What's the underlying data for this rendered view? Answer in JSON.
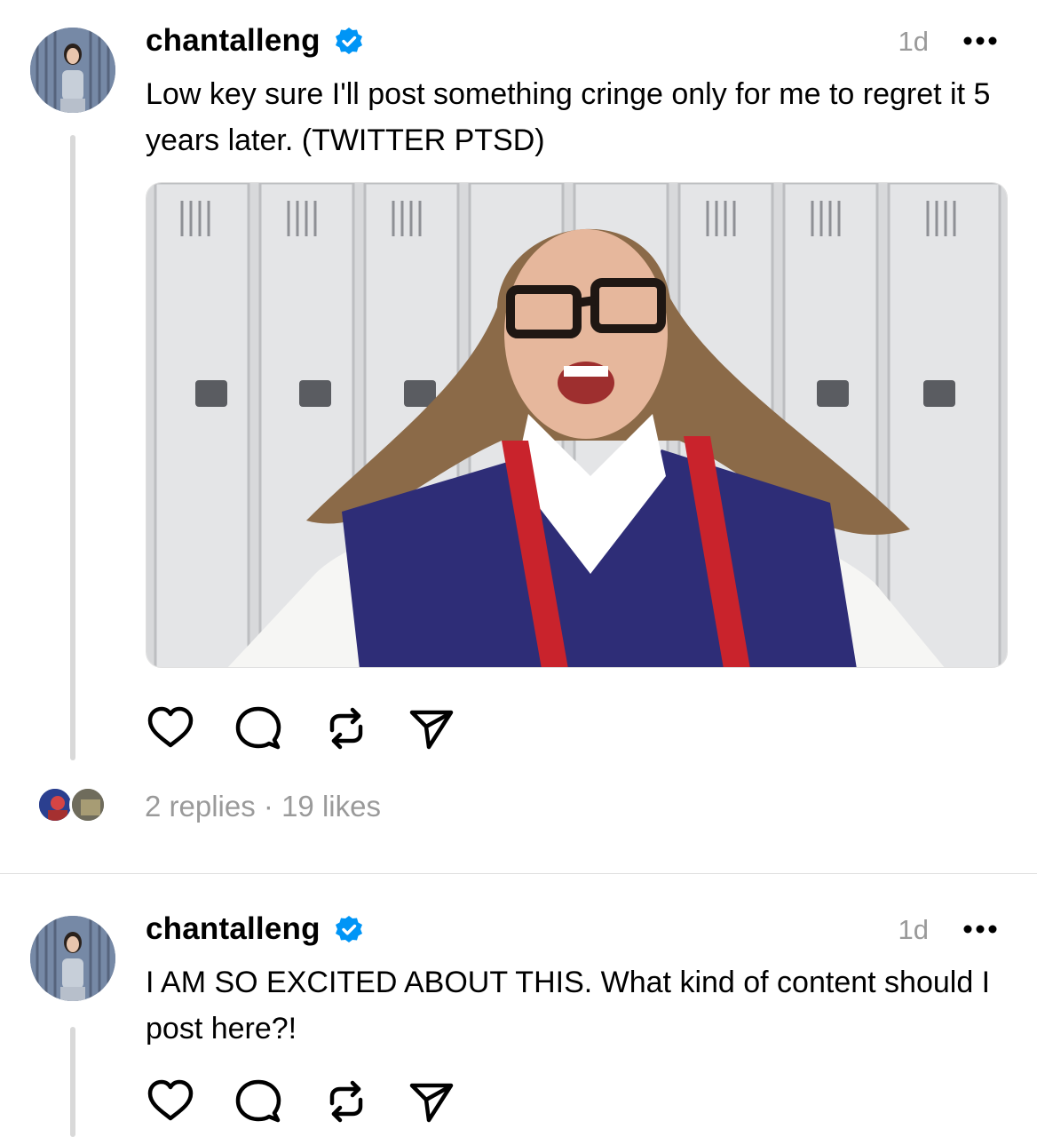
{
  "posts": [
    {
      "username": "chantalleng",
      "time": "1d",
      "text": "Low key sure I'll post something cringe only for me to regret it 5 years later. (TWITTER PTSD)",
      "has_media": true,
      "stats": {
        "replies": "2 replies",
        "separator": "·",
        "likes": "19 likes"
      }
    },
    {
      "username": "chantalleng",
      "time": "1d",
      "text": "I AM SO EXCITED ABOUT THIS. What kind of content should I post here?!",
      "has_media": false
    }
  ],
  "icons": {
    "verified": "verified-badge-icon",
    "more": "more-options-icon",
    "like": "heart-icon",
    "reply": "comment-icon",
    "repost": "repost-icon",
    "share": "send-icon"
  },
  "colors": {
    "verified_blue": "#0095f6",
    "meta_gray": "#9a9a9a",
    "thread_line": "#d9d9d9"
  }
}
